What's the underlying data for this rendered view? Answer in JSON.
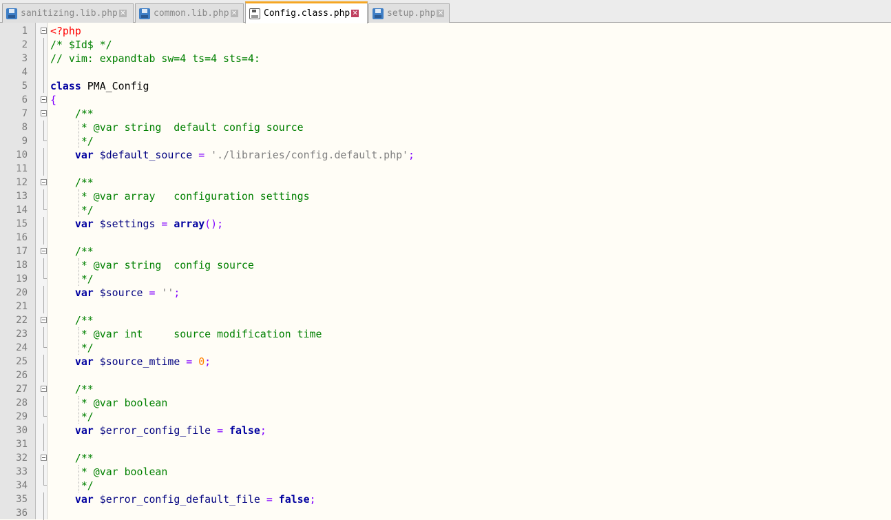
{
  "tabs": [
    {
      "label": "sanitizing.lib.php",
      "active": false
    },
    {
      "label": "common.lib.php",
      "active": false
    },
    {
      "label": "Config.class.php",
      "active": true
    },
    {
      "label": "setup.php",
      "active": false
    }
  ],
  "close_glyph": "✕",
  "colors": {
    "keyword": "#0000a0",
    "comment": "#008000",
    "php_tag": "#ff0000",
    "string": "#808080",
    "number": "#ff8000",
    "operator": "#8000ff",
    "active_tab_accent": "#f5a623"
  },
  "lines": [
    {
      "n": "1",
      "fold": "box",
      "tokens": [
        {
          "t": "php",
          "v": "<?php"
        }
      ]
    },
    {
      "n": "2",
      "fold": "line",
      "tokens": [
        {
          "t": "cm",
          "v": "/* $Id$ */"
        }
      ]
    },
    {
      "n": "3",
      "fold": "line",
      "tokens": [
        {
          "t": "cm",
          "v": "// vim: expandtab sw=4 ts=4 sts=4:"
        }
      ]
    },
    {
      "n": "4",
      "fold": "line",
      "tokens": []
    },
    {
      "n": "5",
      "fold": "line",
      "tokens": [
        {
          "t": "kw",
          "v": "class"
        },
        {
          "t": "plain",
          "v": " PMA_Config"
        }
      ]
    },
    {
      "n": "6",
      "fold": "box",
      "tokens": [
        {
          "t": "brace",
          "v": "{"
        }
      ]
    },
    {
      "n": "7",
      "fold": "box",
      "tokens": [
        {
          "t": "plain",
          "v": "    "
        },
        {
          "t": "cm",
          "v": "/**"
        }
      ]
    },
    {
      "n": "8",
      "fold": "line",
      "tokens": [
        {
          "t": "plain",
          "v": "     "
        },
        {
          "t": "cm",
          "v": "* @var string  default config source"
        }
      ]
    },
    {
      "n": "9",
      "fold": "end",
      "tokens": [
        {
          "t": "plain",
          "v": "     "
        },
        {
          "t": "cm",
          "v": "*/"
        }
      ]
    },
    {
      "n": "10",
      "fold": "line",
      "tokens": [
        {
          "t": "plain",
          "v": "    "
        },
        {
          "t": "kw",
          "v": "var"
        },
        {
          "t": "plain",
          "v": " "
        },
        {
          "t": "var",
          "v": "$default_source"
        },
        {
          "t": "plain",
          "v": " "
        },
        {
          "t": "op",
          "v": "="
        },
        {
          "t": "plain",
          "v": " "
        },
        {
          "t": "str",
          "v": "'./libraries/config.default.php'"
        },
        {
          "t": "op",
          "v": ";"
        }
      ]
    },
    {
      "n": "11",
      "fold": "line",
      "tokens": []
    },
    {
      "n": "12",
      "fold": "box",
      "tokens": [
        {
          "t": "plain",
          "v": "    "
        },
        {
          "t": "cm",
          "v": "/**"
        }
      ]
    },
    {
      "n": "13",
      "fold": "line",
      "tokens": [
        {
          "t": "plain",
          "v": "     "
        },
        {
          "t": "cm",
          "v": "* @var array   configuration settings"
        }
      ]
    },
    {
      "n": "14",
      "fold": "end",
      "tokens": [
        {
          "t": "plain",
          "v": "     "
        },
        {
          "t": "cm",
          "v": "*/"
        }
      ]
    },
    {
      "n": "15",
      "fold": "line",
      "tokens": [
        {
          "t": "plain",
          "v": "    "
        },
        {
          "t": "kw",
          "v": "var"
        },
        {
          "t": "plain",
          "v": " "
        },
        {
          "t": "var",
          "v": "$settings"
        },
        {
          "t": "plain",
          "v": " "
        },
        {
          "t": "op",
          "v": "="
        },
        {
          "t": "plain",
          "v": " "
        },
        {
          "t": "kw",
          "v": "array"
        },
        {
          "t": "op",
          "v": "();"
        }
      ]
    },
    {
      "n": "16",
      "fold": "line",
      "tokens": []
    },
    {
      "n": "17",
      "fold": "box",
      "tokens": [
        {
          "t": "plain",
          "v": "    "
        },
        {
          "t": "cm",
          "v": "/**"
        }
      ]
    },
    {
      "n": "18",
      "fold": "line",
      "tokens": [
        {
          "t": "plain",
          "v": "     "
        },
        {
          "t": "cm",
          "v": "* @var string  config source"
        }
      ]
    },
    {
      "n": "19",
      "fold": "end",
      "tokens": [
        {
          "t": "plain",
          "v": "     "
        },
        {
          "t": "cm",
          "v": "*/"
        }
      ]
    },
    {
      "n": "20",
      "fold": "line",
      "tokens": [
        {
          "t": "plain",
          "v": "    "
        },
        {
          "t": "kw",
          "v": "var"
        },
        {
          "t": "plain",
          "v": " "
        },
        {
          "t": "var",
          "v": "$source"
        },
        {
          "t": "plain",
          "v": " "
        },
        {
          "t": "op",
          "v": "="
        },
        {
          "t": "plain",
          "v": " "
        },
        {
          "t": "str",
          "v": "''"
        },
        {
          "t": "op",
          "v": ";"
        }
      ]
    },
    {
      "n": "21",
      "fold": "line",
      "tokens": []
    },
    {
      "n": "22",
      "fold": "box",
      "tokens": [
        {
          "t": "plain",
          "v": "    "
        },
        {
          "t": "cm",
          "v": "/**"
        }
      ]
    },
    {
      "n": "23",
      "fold": "line",
      "tokens": [
        {
          "t": "plain",
          "v": "     "
        },
        {
          "t": "cm",
          "v": "* @var int     source modification time"
        }
      ]
    },
    {
      "n": "24",
      "fold": "end",
      "tokens": [
        {
          "t": "plain",
          "v": "     "
        },
        {
          "t": "cm",
          "v": "*/"
        }
      ]
    },
    {
      "n": "25",
      "fold": "line",
      "tokens": [
        {
          "t": "plain",
          "v": "    "
        },
        {
          "t": "kw",
          "v": "var"
        },
        {
          "t": "plain",
          "v": " "
        },
        {
          "t": "var",
          "v": "$source_mtime"
        },
        {
          "t": "plain",
          "v": " "
        },
        {
          "t": "op",
          "v": "="
        },
        {
          "t": "plain",
          "v": " "
        },
        {
          "t": "num",
          "v": "0"
        },
        {
          "t": "op",
          "v": ";"
        }
      ]
    },
    {
      "n": "26",
      "fold": "line",
      "tokens": []
    },
    {
      "n": "27",
      "fold": "box",
      "tokens": [
        {
          "t": "plain",
          "v": "    "
        },
        {
          "t": "cm",
          "v": "/**"
        }
      ]
    },
    {
      "n": "28",
      "fold": "line",
      "tokens": [
        {
          "t": "plain",
          "v": "     "
        },
        {
          "t": "cm",
          "v": "* @var boolean"
        }
      ]
    },
    {
      "n": "29",
      "fold": "end",
      "tokens": [
        {
          "t": "plain",
          "v": "     "
        },
        {
          "t": "cm",
          "v": "*/"
        }
      ]
    },
    {
      "n": "30",
      "fold": "line",
      "tokens": [
        {
          "t": "plain",
          "v": "    "
        },
        {
          "t": "kw",
          "v": "var"
        },
        {
          "t": "plain",
          "v": " "
        },
        {
          "t": "var",
          "v": "$error_config_file"
        },
        {
          "t": "plain",
          "v": " "
        },
        {
          "t": "op",
          "v": "="
        },
        {
          "t": "plain",
          "v": " "
        },
        {
          "t": "kw",
          "v": "false"
        },
        {
          "t": "op",
          "v": ";"
        }
      ]
    },
    {
      "n": "31",
      "fold": "line",
      "tokens": []
    },
    {
      "n": "32",
      "fold": "box",
      "tokens": [
        {
          "t": "plain",
          "v": "    "
        },
        {
          "t": "cm",
          "v": "/**"
        }
      ]
    },
    {
      "n": "33",
      "fold": "line",
      "tokens": [
        {
          "t": "plain",
          "v": "     "
        },
        {
          "t": "cm",
          "v": "* @var boolean"
        }
      ]
    },
    {
      "n": "34",
      "fold": "end",
      "tokens": [
        {
          "t": "plain",
          "v": "     "
        },
        {
          "t": "cm",
          "v": "*/"
        }
      ]
    },
    {
      "n": "35",
      "fold": "line",
      "tokens": [
        {
          "t": "plain",
          "v": "    "
        },
        {
          "t": "kw",
          "v": "var"
        },
        {
          "t": "plain",
          "v": " "
        },
        {
          "t": "var",
          "v": "$error_config_default_file"
        },
        {
          "t": "plain",
          "v": " "
        },
        {
          "t": "op",
          "v": "="
        },
        {
          "t": "plain",
          "v": " "
        },
        {
          "t": "kw",
          "v": "false"
        },
        {
          "t": "op",
          "v": ";"
        }
      ]
    },
    {
      "n": "36",
      "fold": "line",
      "tokens": []
    }
  ]
}
